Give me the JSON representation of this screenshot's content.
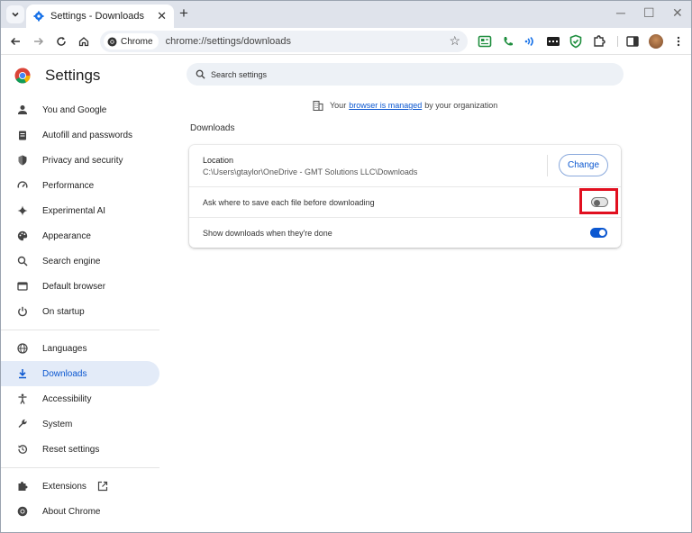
{
  "browser": {
    "tab_title": "Settings - Downloads",
    "chip_label": "Chrome",
    "url": "chrome://settings/downloads"
  },
  "settings": {
    "title": "Settings",
    "search_placeholder": "Search settings",
    "managed": {
      "prefix": "Your",
      "link": "browser is managed",
      "suffix": "by your organization"
    },
    "nav": {
      "you_and_google": "You and Google",
      "autofill": "Autofill and passwords",
      "privacy": "Privacy and security",
      "performance": "Performance",
      "experimental_ai": "Experimental AI",
      "appearance": "Appearance",
      "search_engine": "Search engine",
      "default_browser": "Default browser",
      "on_startup": "On startup",
      "languages": "Languages",
      "downloads": "Downloads",
      "accessibility": "Accessibility",
      "system": "System",
      "reset": "Reset settings",
      "extensions": "Extensions",
      "about": "About Chrome"
    },
    "section_title": "Downloads",
    "location_label": "Location",
    "location_path": "C:\\Users\\gtaylor\\OneDrive - GMT Solutions LLC\\Downloads",
    "change_button": "Change",
    "ask_where_label": "Ask where to save each file before downloading",
    "ask_where_enabled": false,
    "show_downloads_label": "Show downloads when they're done",
    "show_downloads_enabled": true
  },
  "colors": {
    "accent": "#0b57d0",
    "highlight": "#e10f1f",
    "active_nav_bg": "#e3ebf8"
  }
}
